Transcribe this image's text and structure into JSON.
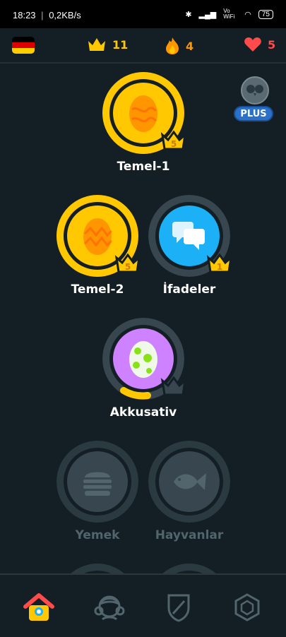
{
  "status_bar": {
    "time": "18:23",
    "speed": "0,2KB/s",
    "vo_wifi": "Vo WiFi",
    "battery": "75"
  },
  "top_bar": {
    "flag_language": "German",
    "crowns": "11",
    "streak": "4",
    "hearts": "5"
  },
  "plus_badge": "PLUS",
  "skills": [
    {
      "name": "Temel-1",
      "level": "5",
      "state": "gold"
    },
    {
      "name": "Temel-2",
      "level": "5",
      "state": "gold"
    },
    {
      "name": "İfadeler",
      "level": "1",
      "state": "blue"
    },
    {
      "name": "Akkusativ",
      "level": "",
      "state": "purple-in-progress"
    },
    {
      "name": "Yemek",
      "level": "",
      "state": "locked"
    },
    {
      "name": "Hayvanlar",
      "level": "",
      "state": "locked"
    }
  ],
  "colors": {
    "background": "#131f24",
    "gold": "#ffc800",
    "blue": "#1cb0f6",
    "purple": "#ce82ff",
    "locked": "#37464f",
    "streak_orange": "#ff9600",
    "heart_red": "#ff4b4b"
  },
  "bottom_nav": [
    "home-icon",
    "character-icon",
    "league-shield-icon",
    "shop-hex-icon"
  ]
}
